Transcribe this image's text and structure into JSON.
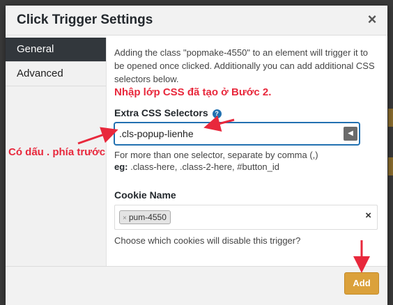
{
  "modal": {
    "title": "Click Trigger Settings",
    "close_label": "×"
  },
  "tabs": [
    {
      "label": "General",
      "active": true
    },
    {
      "label": "Advanced",
      "active": false
    }
  ],
  "general": {
    "intro": "Adding the class \"popmake-4550\" to an element will trigger it to be opened once clicked. Additionally you can add additional CSS selectors below.",
    "extra_css": {
      "label": "Extra CSS Selectors",
      "help_icon": "?",
      "value": ".cls-popup-lienhe",
      "desc_line1": "For more than one selector, separate by comma (,)",
      "desc_eg_label": "eg:",
      "desc_eg_text": " .class-here, .class-2-here, #button_id"
    },
    "cookie": {
      "label": "Cookie Name",
      "chips": [
        "pum-4550"
      ],
      "chip_remove": "×",
      "clear_label": "×",
      "desc": "Choose which cookies will disable this trigger?"
    }
  },
  "footer": {
    "add_label": "Add"
  },
  "annotations": {
    "step_note": "Nhập lớp CSS đã tạo ở Bước 2.",
    "dot_note": "Có dấu . phía trước"
  },
  "colors": {
    "accent_button": "#dba13b",
    "annotation_red": "#e8283c",
    "active_tab": "#32373c",
    "focus_blue": "#2271b1"
  }
}
